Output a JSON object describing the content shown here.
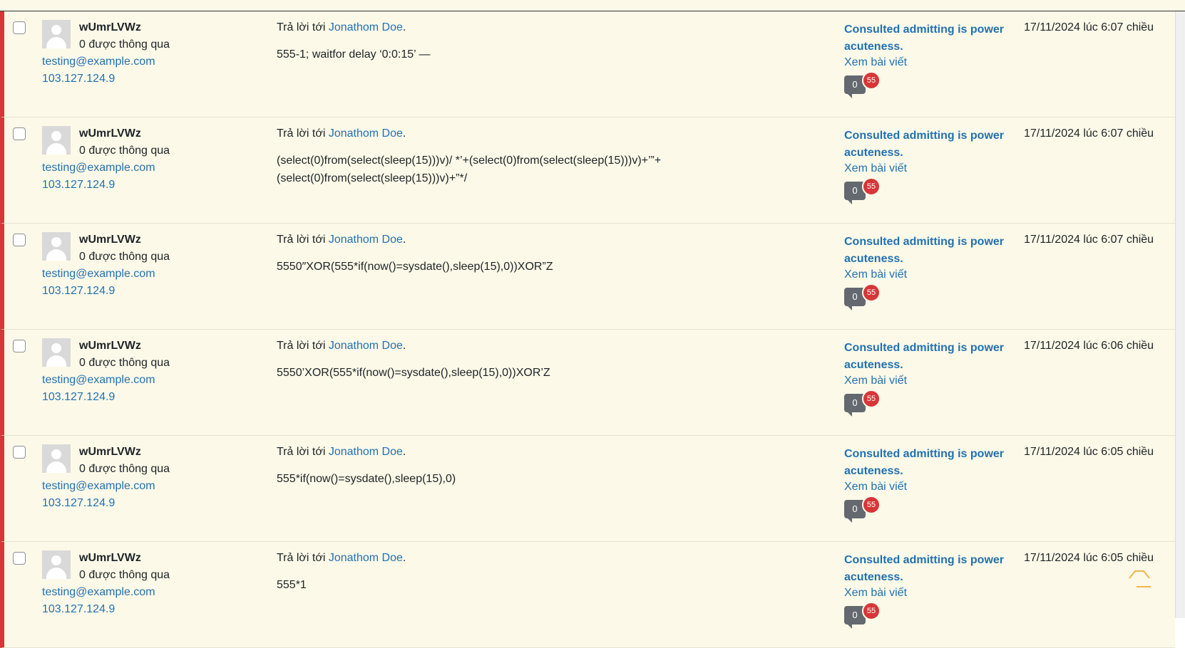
{
  "rows": [
    {
      "author": "wUmrLVWz",
      "approved": "0 được thông qua",
      "email": "testing@example.com",
      "ip": "103.127.124.9",
      "reply_prefix": "Trả lời tới",
      "reply_to": "Jonathom Doe",
      "reply_suffix": ".",
      "content": "555-1; waitfor delay ‘0:0:15’ —",
      "post_title": "Consulted admitting is power acuteness.",
      "view_post": "Xem bài viết",
      "approved_count": "0",
      "pending_count": "55",
      "date": "17/11/2024 lúc 6:07 chiều"
    },
    {
      "author": "wUmrLVWz",
      "approved": "0 được thông qua",
      "email": "testing@example.com",
      "ip": "103.127.124.9",
      "reply_prefix": "Trả lời tới",
      "reply_to": "Jonathom Doe",
      "reply_suffix": ".",
      "content": "(select(0)from(select(sleep(15)))v)/ *’+(select(0)from(select(sleep(15)))v)+’”+(select(0)from(select(sleep(15)))v)+”*/",
      "post_title": "Consulted admitting is power acuteness.",
      "view_post": "Xem bài viết",
      "approved_count": "0",
      "pending_count": "55",
      "date": "17/11/2024 lúc 6:07 chiều"
    },
    {
      "author": "wUmrLVWz",
      "approved": "0 được thông qua",
      "email": "testing@example.com",
      "ip": "103.127.124.9",
      "reply_prefix": "Trả lời tới",
      "reply_to": "Jonathom Doe",
      "reply_suffix": ".",
      "content": "5550″XOR(555*if(now()=sysdate(),sleep(15),0))XOR”Z",
      "post_title": "Consulted admitting is power acuteness.",
      "view_post": "Xem bài viết",
      "approved_count": "0",
      "pending_count": "55",
      "date": "17/11/2024 lúc 6:07 chiều"
    },
    {
      "author": "wUmrLVWz",
      "approved": "0 được thông qua",
      "email": "testing@example.com",
      "ip": "103.127.124.9",
      "reply_prefix": "Trả lời tới",
      "reply_to": "Jonathom Doe",
      "reply_suffix": ".",
      "content": "5550’XOR(555*if(now()=sysdate(),sleep(15),0))XOR’Z",
      "post_title": "Consulted admitting is power acuteness.",
      "view_post": "Xem bài viết",
      "approved_count": "0",
      "pending_count": "55",
      "date": "17/11/2024 lúc 6:06 chiều"
    },
    {
      "author": "wUmrLVWz",
      "approved": "0 được thông qua",
      "email": "testing@example.com",
      "ip": "103.127.124.9",
      "reply_prefix": "Trả lời tới",
      "reply_to": "Jonathom Doe",
      "reply_suffix": ".",
      "content": "555*if(now()=sysdate(),sleep(15),0)",
      "post_title": "Consulted admitting is power acuteness.",
      "view_post": "Xem bài viết",
      "approved_count": "0",
      "pending_count": "55",
      "date": "17/11/2024 lúc 6:05 chiều"
    },
    {
      "author": "wUmrLVWz",
      "approved": "0 được thông qua",
      "email": "testing@example.com",
      "ip": "103.127.124.9",
      "reply_prefix": "Trả lời tới",
      "reply_to": "Jonathom Doe",
      "reply_suffix": ".",
      "content": "555*1",
      "post_title": "Consulted admitting is power acuteness.",
      "view_post": "Xem bài viết",
      "approved_count": "0",
      "pending_count": "55",
      "date": "17/11/2024 lúc 6:05 chiều"
    }
  ],
  "colors": {
    "pending_border": "#d63638",
    "row_bg": "#fcf9e8",
    "link": "#2271b1",
    "badge": "#d63638",
    "to_top": "#f0b849"
  },
  "icons": {
    "avatar": "default-avatar-icon",
    "comment_bubble": "comment-bubble-icon",
    "to_top": "scroll-to-top-icon"
  }
}
